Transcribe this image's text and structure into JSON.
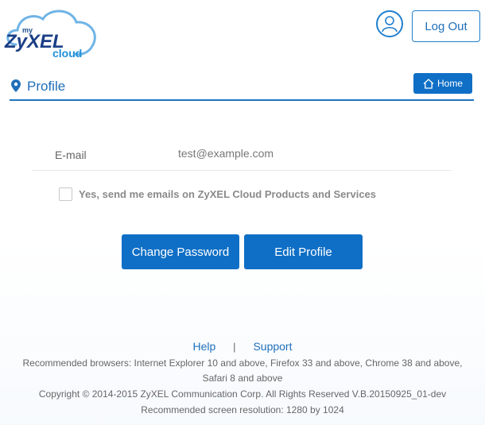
{
  "header": {
    "logo": {
      "prefix": "my",
      "brand": "ZyXEL",
      "product": "cloud"
    },
    "user_icon": "user-circle-icon",
    "logout_label": "Log Out"
  },
  "title_bar": {
    "icon": "map-pin-icon",
    "title": "Profile",
    "home_icon": "home-icon",
    "home_label": "Home"
  },
  "profile": {
    "email_label": "E-mail",
    "email_value": "test@example.com",
    "subscribe_checked": false,
    "subscribe_label": "Yes, send me emails on ZyXEL Cloud Products and Services"
  },
  "actions": {
    "change_password_label": "Change Password",
    "edit_profile_label": "Edit Profile"
  },
  "footer": {
    "help_label": "Help",
    "separator": "|",
    "support_label": "Support",
    "browsers": "Recommended browsers: Internet Explorer 10 and above, Firefox 33 and above, Chrome 38 and above, Safari 8 and above",
    "copyright": "Copyright © 2014-2015 ZyXEL Communication Corp. All Rights Reserved V.B.20150925_01-dev",
    "resolution": "Recommended screen resolution: 1280 by 1024"
  },
  "colors": {
    "primary": "#0f6fc6",
    "accent_text": "#1f6fba",
    "underline": "#1c74c1"
  }
}
